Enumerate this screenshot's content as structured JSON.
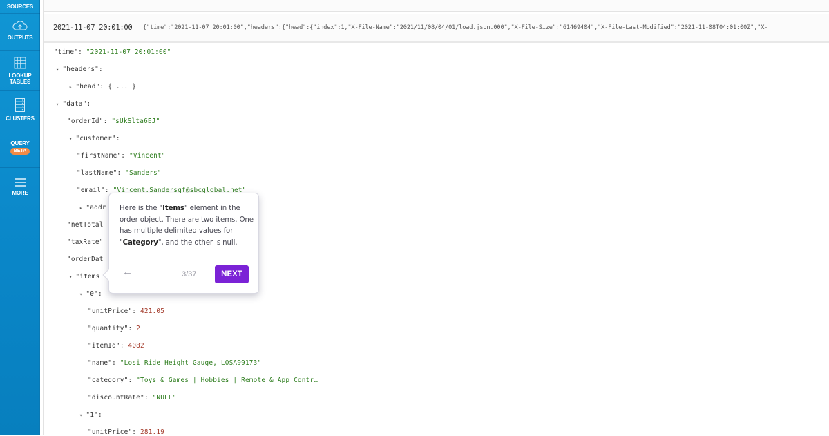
{
  "sidebar": {
    "items": [
      {
        "label": "SOURCES",
        "icon": "sources-icon"
      },
      {
        "label": "OUTPUTS",
        "icon": "cloud-upload-icon"
      },
      {
        "label": "LOOKUP TABLES",
        "line1": "LOOKUP",
        "line2": "TABLES",
        "icon": "table-grid-icon"
      },
      {
        "label": "CLUSTERS",
        "icon": "server-rack-icon"
      },
      {
        "label": "QUERY",
        "badge": "BETA",
        "icon": ""
      },
      {
        "label": "MORE",
        "icon": "hamburger-menu-icon"
      }
    ]
  },
  "log_row": {
    "timestamp": "2021-11-07 20:01:00",
    "raw": "{\"time\":\"2021-11-07 20:01:00\",\"headers\":{\"head\":{\"index\":1,\"X-File-Name\":\"2021/11/08/04/01/load.json.000\",\"X-File-Size\":\"61469404\",\"X-File-Last-Modified\":\"2021-11-08T04:01:00Z\",\"X-"
  },
  "tree": {
    "time": {
      "key": "\"time\":",
      "value": "\"2021-11-07 20:01:00\""
    },
    "headers": {
      "key": "\"headers\":"
    },
    "head": {
      "key": "\"head\":",
      "value": "{ ... }"
    },
    "data": {
      "key": "\"data\":"
    },
    "orderId": {
      "key": "\"orderId\":",
      "value": "\"sUkSlta6EJ\""
    },
    "customer": {
      "key": "\"customer\":"
    },
    "firstName": {
      "key": "\"firstName\":",
      "value": "\"Vincent\""
    },
    "lastName": {
      "key": "\"lastName\":",
      "value": "\"Sanders\""
    },
    "email": {
      "key": "\"email\":",
      "value": "\"Vincent.Sandersqf@sbcglobal.net\""
    },
    "address": {
      "key": "\"addr"
    },
    "netTotal": {
      "key": "\"netTotal"
    },
    "taxRate": {
      "key": "\"taxRate\""
    },
    "orderDate": {
      "key": "\"orderDat"
    },
    "items": {
      "key": "\"items"
    },
    "item0": {
      "key": "\"0\":"
    },
    "unitPrice0": {
      "key": "\"unitPrice\":",
      "value": "421.05"
    },
    "quantity0": {
      "key": "\"quantity\":",
      "value": "2"
    },
    "itemId0": {
      "key": "\"itemId\":",
      "value": "4082"
    },
    "name0": {
      "key": "\"name\":",
      "value": "\"Losi Ride Height Gauge, LOSA99173\""
    },
    "category0": {
      "key": "\"category\":",
      "value": "\"Toys & Games | Hobbies | Remote & App Contr…"
    },
    "discountRate0": {
      "key": "\"discountRate\":",
      "value": "\"NULL\""
    },
    "item1": {
      "key": "\"1\":"
    },
    "unitPrice1": {
      "key": "\"unitPrice\":",
      "value": "281.19"
    }
  },
  "tooltip": {
    "p1": "Here is the \"",
    "b1": "Items",
    "p2": "\" element in the order object. There are two items.  One has multiple delimited values for \"",
    "b2": "Category",
    "p3": "\", and the other is null.",
    "step": "3/37",
    "next_label": "NEXT",
    "back_icon": "arrow-left-icon"
  },
  "colors": {
    "sidebar": "#0a86c8",
    "beta_badge": "#f28a45",
    "next_button": "#7b22d6",
    "json_string": "#2e7d1e",
    "json_number": "#a33a2a"
  }
}
